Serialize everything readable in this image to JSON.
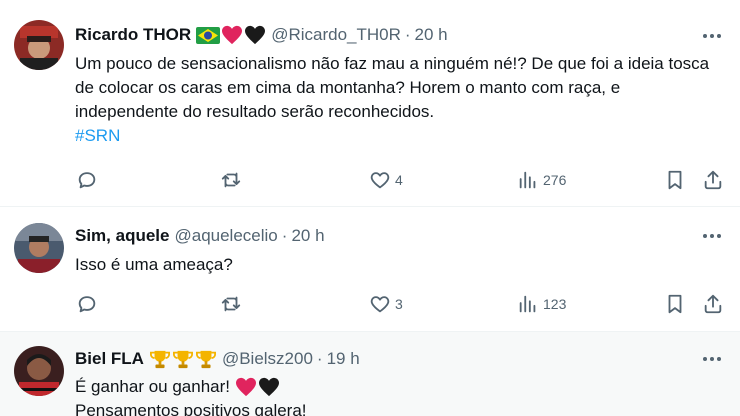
{
  "tweets": [
    {
      "name": "Ricardo THOR",
      "handle": "@Ricardo_TH0R",
      "time": "20 h",
      "text": "Um pouco de sensacionalismo não faz mau a ninguém né!? De que foi a ideia tosca de colocar os caras em cima da montanha? Horem o manto com raça, e independente do resultado serão reconhecidos.",
      "hashtag": "#SRN",
      "likes": "4",
      "views": "276",
      "emojis": [
        "brazil-flag",
        "red-heart",
        "black-heart"
      ]
    },
    {
      "name": "Sim, aquele",
      "handle": "@aquelecelio",
      "time": "20 h",
      "text": "Isso é uma ameaça?",
      "likes": "3",
      "views": "123"
    },
    {
      "name": "Biel FLA",
      "handle": "@Bielsz200",
      "time": "19 h",
      "text_line1": "É ganhar ou ganhar!",
      "text_line2": "Pensamentos positivos galera!",
      "emojis": [
        "trophy",
        "trophy",
        "trophy"
      ],
      "text_emojis": [
        "red-heart",
        "black-heart"
      ]
    }
  ],
  "dot": "·",
  "colors": {
    "text": "#0f1419",
    "muted": "#536471",
    "link": "#1d9bf0",
    "divider": "#eff3f4",
    "highlight_bg": "#f7f9f9"
  }
}
